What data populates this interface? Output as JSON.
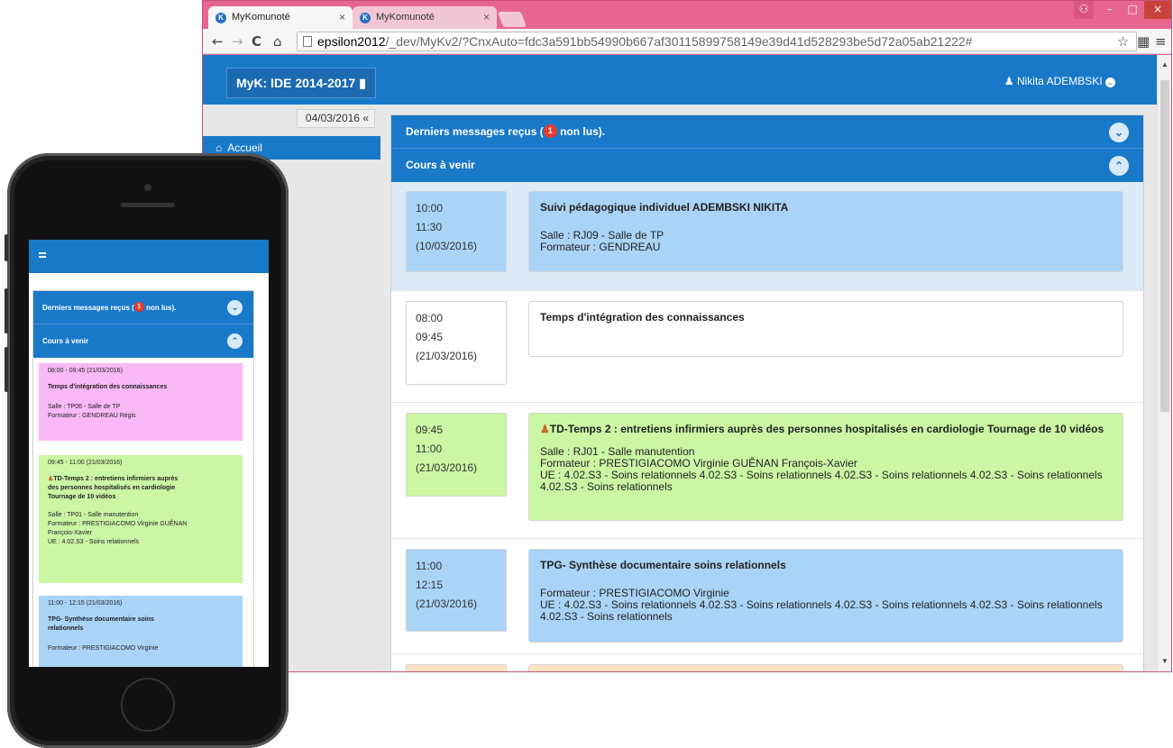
{
  "browser": {
    "tabs": [
      {
        "title": "MyKomunoté",
        "close": "×"
      },
      {
        "title": "MyKomunoté",
        "close": "×"
      }
    ],
    "window_controls": {
      "user": "⚇",
      "minimize": "–",
      "maximize": "□",
      "close": "×"
    },
    "url_host": "epsilon2012",
    "url_rest": "/_dev/MyKv2/?CnxAuto=fdc3a591bb54990b667af30115899758149e39d41d528293be5d72a05ab21222#"
  },
  "app": {
    "brand": "MyK: IDE 2014-2017",
    "user": "Nikita ADEMBSKI",
    "date": "04/03/2016",
    "sidebar_home": "Accueil",
    "messages_header_prefix": "Derniers messages reçus (",
    "messages_count": "1",
    "messages_header_suffix": " non lus).",
    "courses_header": "Cours à venir",
    "courses": [
      {
        "start": "10:00",
        "end": "11:30",
        "date": "(10/03/2016)",
        "title": "Suivi pédagogique individuel ADEMBSKI NIKITA",
        "lines": [
          "Salle : RJ09 - Salle de TP",
          "Formateur : GENDREAU"
        ],
        "color": "#a9d4f8"
      },
      {
        "start": "08:00",
        "end": "09:45",
        "date": "(21/03/2016)",
        "title": "Temps d'intégration des connaissances",
        "lines": [],
        "color": "#ffffff"
      },
      {
        "start": "09:45",
        "end": "11:00",
        "date": "(21/03/2016)",
        "title": "TD-Temps 2 : entretiens infirmiers auprès des personnes hospitalisés en cardiologie Tournage de 10 vidéos",
        "lines": [
          "Salle : RJ01 - Salle manutention",
          "Formateur : PRESTIGIACOMO Virginie GUÊNAN François-Xavier",
          "UE : 4.02.S3 - Soins relationnels 4.02.S3 - Soins relationnels 4.02.S3 - Soins relationnels 4.02.S3 - Soins relationnels",
          "4.02.S3 - Soins relationnels"
        ],
        "color": "#cbf6a3"
      },
      {
        "start": "11:00",
        "end": "12:15",
        "date": "(21/03/2016)",
        "title": "TPG- Synthèse documentaire soins relationnels",
        "lines": [
          "Formateur : PRESTIGIACOMO Virginie",
          "UE : 4.02.S3 - Soins relationnels 4.02.S3 - Soins relationnels 4.02.S3 - Soins relationnels 4.02.S3 - Soins relationnels",
          "4.02.S3 - Soins relationnels"
        ],
        "color": "#a9d4f8"
      }
    ]
  },
  "mobile": {
    "messages_header_prefix": "Derniers messages reçus (",
    "messages_count": "1",
    "messages_header_suffix": " non lus).",
    "courses_header": "Cours à venir",
    "cards": [
      {
        "time": "08:00 - 09:45 (21/03/2016)",
        "title": "Temps d'intégration des connaissances",
        "lines": [
          "Salle : TP06 - Salle de TP",
          "Formateur : GENDREAU Régis"
        ],
        "color": "#f9b8f6"
      },
      {
        "time": "09:45 - 11:00 (21/03/2016)",
        "title_lines": [
          "TD-Temps 2 : entretiens infirmiers auprès",
          "des personnes hospitalisés en cardiologie",
          "Tournage de 10 vidéos"
        ],
        "lines": [
          "Salle : TP01 - Salle manutention",
          "Formateur : PRESTIGIACOMO Virginie GUÊNAN",
          "François-Xavier",
          "UE : 4.02.S3 - Soins relationnels"
        ],
        "color": "#cbf6a3"
      },
      {
        "time": "11:00 - 12:15 (21/03/2016)",
        "title_lines": [
          "TPG- Synthèse documentaire soins",
          "relationnels"
        ],
        "lines": [
          "Formateur : PRESTIGIACOMO Virginie"
        ],
        "color": "#a9d4f8"
      }
    ]
  }
}
